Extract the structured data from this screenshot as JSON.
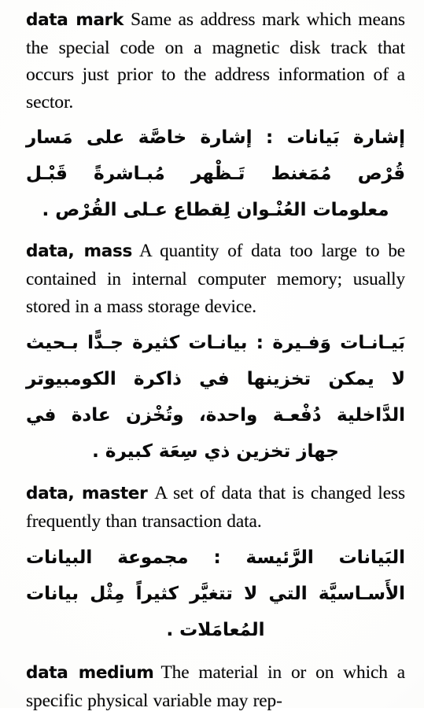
{
  "page": {
    "type": "dictionary-page-scan",
    "language_pair": "English-Arabic",
    "background_color": "#ffffff",
    "text_color": "#0a0a0a"
  },
  "entries": [
    {
      "headword": "data mark",
      "definition": "Same as address mark which means the special code on a magnetic disk track that occurs just prior to the address information of a sector.",
      "arabic": "إشارة بَيانات : إشارة خاصَّة على مَسار قُرْص مُمَغنط تَـظْهر مُبـاشرةً قَبْـل معلومات العُنْـوان لِقطاع عـلى القُرْص ."
    },
    {
      "headword": "data, mass",
      "definition": "A quantity of data too large to be contained in internal computer memory; usually stored in a mass storage device.",
      "arabic": "بَيـانـات وَفـيرة : بيانـات كثيرة جـدًّا بـحيث لا يمكن تخزينها في ذاكرة الكومبيوتر الدَّاخلية دُفْعـة واحدة، وتُخْزن عادة في جهاز تخزين ذي سِعَة كبيرة ."
    },
    {
      "headword": "data, master",
      "definition": "A set of data that is changed less frequently than transaction data.",
      "arabic": "البَيانات الرَّئيسة : مجموعة البيانات الأَسـاسيَّة التي لا تتغيَّر كثيراً مِثْل بيانات المُعامَلات ."
    },
    {
      "headword": "data medium",
      "definition": "The material in or on which a specific physical variable may rep-",
      "arabic": ""
    }
  ]
}
